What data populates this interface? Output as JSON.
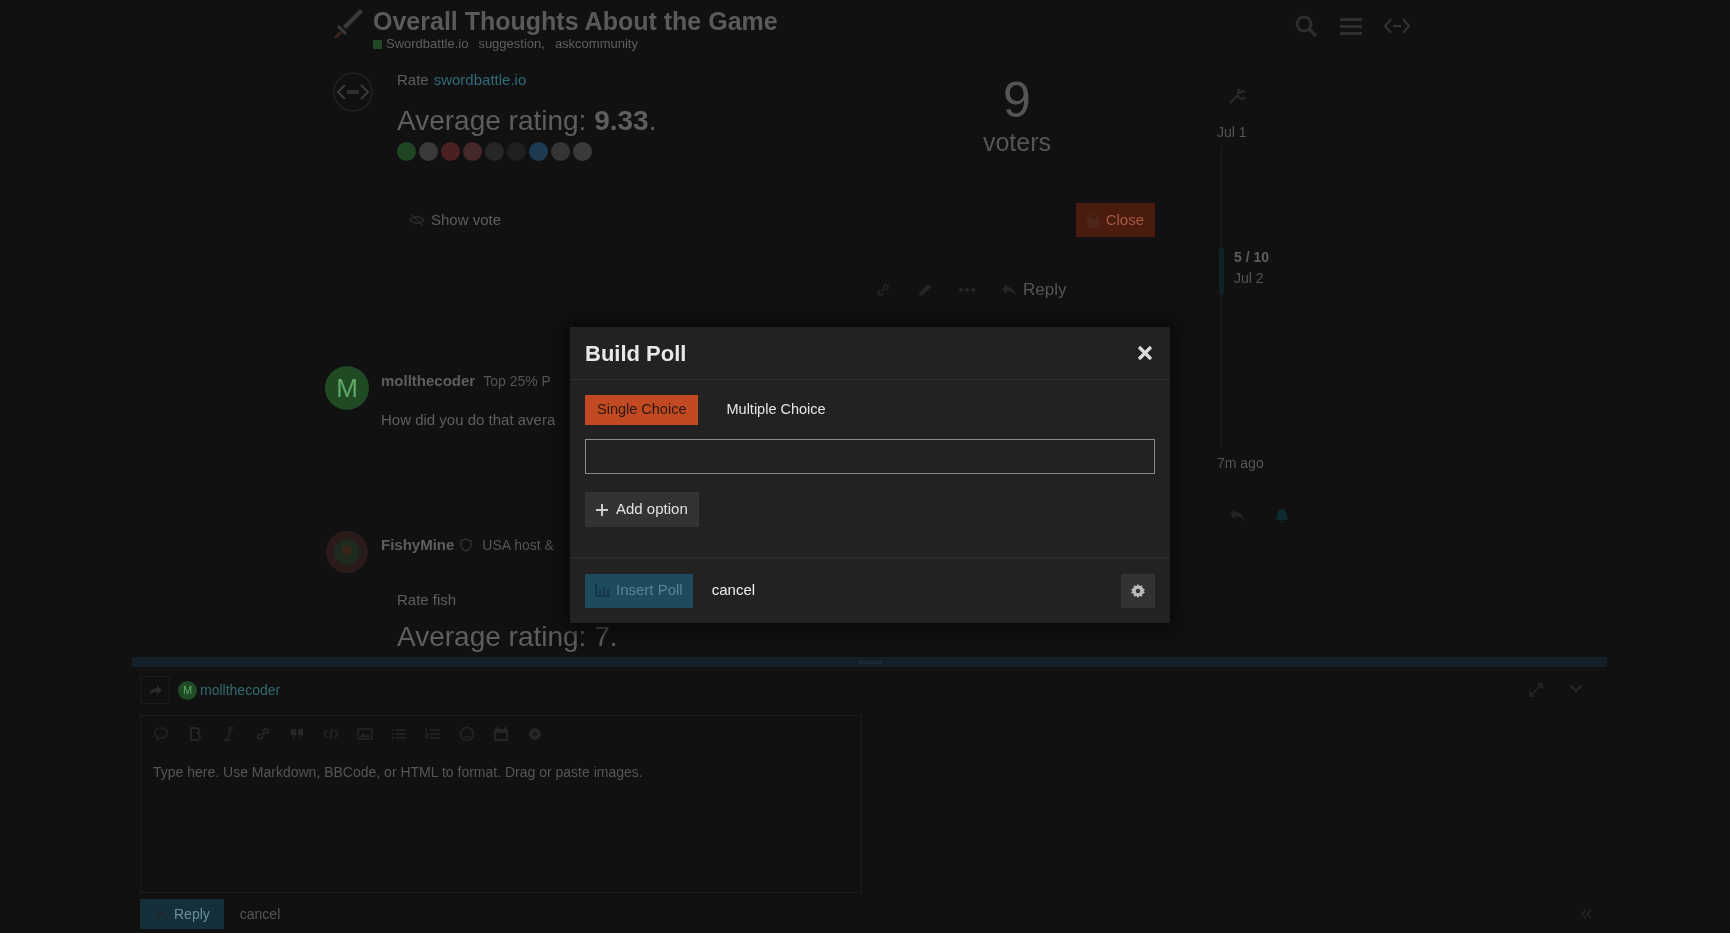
{
  "topic": {
    "title": "Overall Thoughts About the Game",
    "category": {
      "name": "Swordbattle.io",
      "color": "#1f4a24"
    },
    "tags": [
      "suggestion,",
      "askcommunity"
    ]
  },
  "posts": [
    {
      "kind": "poll",
      "intro": "Rate",
      "link": "swordbattle.io",
      "rating": "Average rating: **9.33**.",
      "voters": [
        {
          "color": "#1f4522"
        },
        {
          "color": "#3a3a3a"
        },
        {
          "color": "#4a2020"
        },
        {
          "color": "#452828"
        },
        {
          "color": "#262626"
        },
        {
          "color": "#202020"
        },
        {
          "color": "#1d3a50"
        },
        {
          "color": "#353535"
        },
        {
          "color": "#3a3a3a"
        }
      ],
      "voter_count": "9",
      "voter_label": "voters",
      "show_vote": "Show vote",
      "close_button": "Close",
      "reply_button": "Reply"
    },
    {
      "kind": "reply",
      "avatar_letter": "M",
      "username": "mollthecoder",
      "user_title": "Top 25% P",
      "body": "How did you do that avera"
    },
    {
      "kind": "poll_preview",
      "username": "FishyMine",
      "user_title": "USA host &",
      "intro": "Rate fish",
      "rating": "Average rating: 7."
    }
  ],
  "timeline": {
    "start": "Jul 1",
    "position": "5 / 10",
    "position_date": "Jul 2",
    "end": "7m ago"
  },
  "composer": {
    "avatar_letter": "M",
    "username": "mollthecoder",
    "placeholder": "Type here. Use Markdown, BBCode, or HTML to format. Drag or paste images.",
    "reply_button": "Reply",
    "cancel": "cancel"
  },
  "modal": {
    "title": "Build Poll",
    "tabs": [
      {
        "label": "Single Choice",
        "selected": true
      },
      {
        "label": "Multiple Choice",
        "selected": false
      }
    ],
    "add_option": "Add option",
    "insert_button": {
      "label": "Insert Poll",
      "disabled": true
    },
    "cancel": "cancel"
  }
}
